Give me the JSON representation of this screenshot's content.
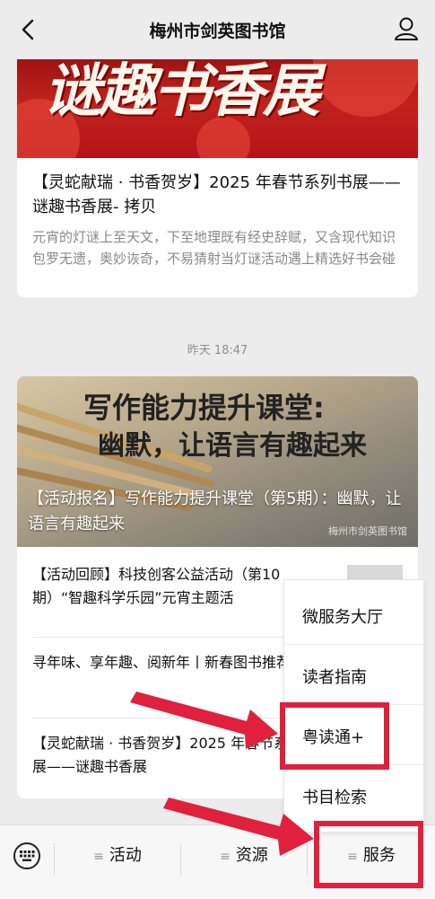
{
  "header": {
    "title": "梅州市剑英图书馆"
  },
  "card1": {
    "banner_text": "谜趣书香展",
    "title": "【灵蛇献瑞 · 书香贺岁】2025 年春节系列书展——谜趣书香展- 拷贝",
    "desc": "元宵的灯谜上至天文，下至地理既有经史辞赋，又含现代知识包罗无遗，奥妙诙奇，不易猜射当灯谜活动遇上精选好书会碰"
  },
  "timestamp": "昨天 18:47",
  "card2": {
    "banner_line1": "写作能力提升课堂:",
    "banner_line2": "幽默，让语言有趣起来",
    "overlay_title": "【活动报名】写作能力提升课堂（第5期）：幽默，让语言有趣起来",
    "watermark": "梅州市剑英图书馆",
    "items": [
      {
        "text": "【活动回顾】科技创客公益活动（第10期）“智趣科学乐园”元宵主题活"
      },
      {
        "text": "寻年味、享年趣、阅新年丨新春图书推荐（四）"
      },
      {
        "text": "【灵蛇献瑞 · 书香贺岁】2025 年春节系列书展——谜趣书香展"
      }
    ]
  },
  "popup_menu": {
    "items": [
      "微服务大厅",
      "读者指南",
      "粤读通+",
      "书目检索"
    ]
  },
  "bottom_menu": {
    "lines_glyph": "≡",
    "items": [
      "活动",
      "资源",
      "服务"
    ]
  },
  "colors": {
    "highlight": "#e0203c",
    "banner_red": "#c0231d"
  }
}
